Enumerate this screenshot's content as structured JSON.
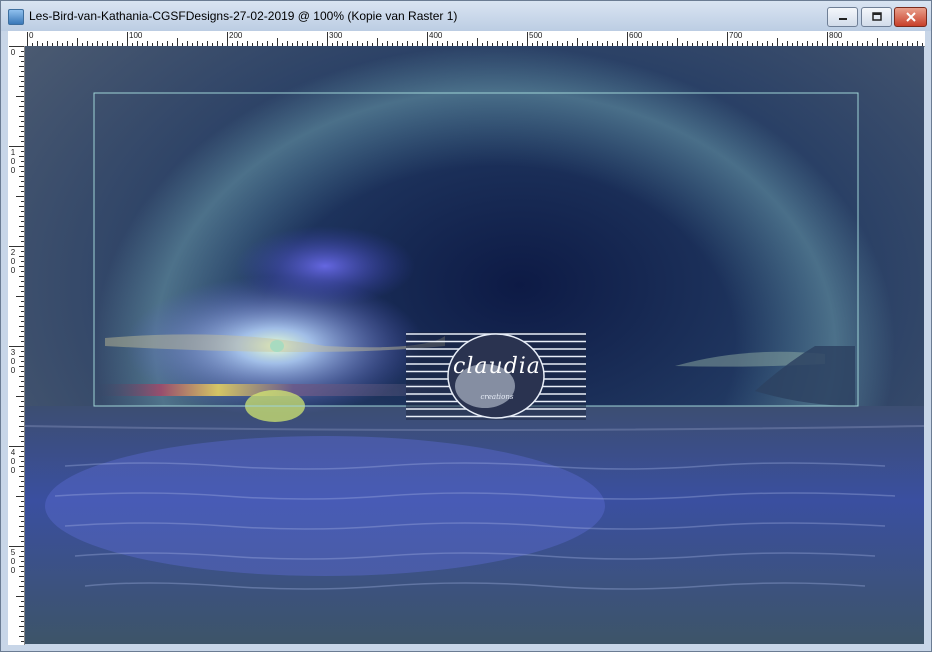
{
  "window": {
    "title": "Les-Bird-van-Kathania-CGSFDesigns-27-02-2019 @ 100% (Kopie van Raster 1)",
    "controls": {
      "minimize_icon": "minimize-icon",
      "maximize_icon": "maximize-icon",
      "close_icon": "close-icon"
    }
  },
  "ruler": {
    "horizontal_labels": [
      "0",
      "100",
      "200",
      "300",
      "400",
      "500",
      "600",
      "700",
      "800"
    ],
    "vertical_labels": [
      [
        "0"
      ],
      [
        "1",
        "0",
        "0"
      ],
      [
        "2",
        "0",
        "0"
      ],
      [
        "3",
        "0",
        "0"
      ],
      [
        "4",
        "0",
        "0"
      ],
      [
        "5",
        "0",
        "0"
      ]
    ]
  },
  "canvas": {
    "watermark_text": "claudia",
    "watermark_subtext": "creations"
  },
  "colors": {
    "titlebar": "#c8d6e8",
    "close_button": "#c8402a",
    "frame_line": "#9fd4d6"
  }
}
